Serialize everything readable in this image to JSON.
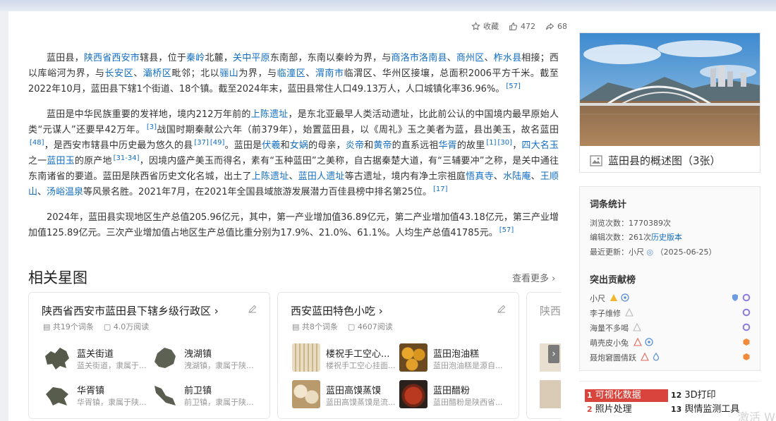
{
  "actions": {
    "favorite": "收藏",
    "likes": "472",
    "shares": "68"
  },
  "article": {
    "p1": [
      {
        "t": "蓝田县，"
      },
      {
        "t": "陕西省西安市",
        "link": true
      },
      {
        "t": "辖县，位于"
      },
      {
        "t": "秦岭",
        "link": true
      },
      {
        "t": "北麓，"
      },
      {
        "t": "关中平原",
        "link": true
      },
      {
        "t": "东南部，东南以秦岭为界，与"
      },
      {
        "t": "商洛市洛南县",
        "link": true
      },
      {
        "t": "、"
      },
      {
        "t": "商州区",
        "link": true
      },
      {
        "t": "、"
      },
      {
        "t": "柞水县",
        "link": true
      },
      {
        "t": "相接；西以库峪河为界，与"
      },
      {
        "t": "长安区",
        "link": true
      },
      {
        "t": "、"
      },
      {
        "t": "灞桥区",
        "link": true
      },
      {
        "t": "毗邻；北以"
      },
      {
        "t": "骊山",
        "link": true
      },
      {
        "t": "为界，与"
      },
      {
        "t": "临潼区",
        "link": true
      },
      {
        "t": "、"
      },
      {
        "t": "渭南市",
        "link": true
      },
      {
        "t": "临渭区、华州区接壤，总面积2006平方千米。截至2022年10月，蓝田县下辖1个街道、18个镇。截至2024年末，蓝田县常住人口49.13万人，人口城镇化率36.96%。"
      },
      {
        "t": "[57]",
        "sup": true
      }
    ],
    "p2": [
      {
        "t": "蓝田是中华民族重要的发祥地，境内212万年前的"
      },
      {
        "t": "上陈遗址",
        "link": true
      },
      {
        "t": "，是东北亚最早人类活动遗址，比此前公认的中国境内最早原始人类“元谋人”还要早42万年。"
      },
      {
        "t": "[3]",
        "sup": true
      },
      {
        "t": "战国时期秦献公六年（前379年），始置蓝田县，以《周礼》玉之美者为蓝，县出美玉，故名蓝田"
      },
      {
        "t": "[48]",
        "sup": true
      },
      {
        "t": "，是西安市辖县中历史最为悠久的县"
      },
      {
        "t": "[37]",
        "sup": true
      },
      {
        "t": "[49]",
        "sup": true
      },
      {
        "t": "。蓝田是"
      },
      {
        "t": "伏羲",
        "link": true
      },
      {
        "t": "和"
      },
      {
        "t": "女娲",
        "link": true
      },
      {
        "t": "的母亲，"
      },
      {
        "t": "炎帝",
        "link": true
      },
      {
        "t": "和"
      },
      {
        "t": "黄帝",
        "link": true
      },
      {
        "t": "的直系远祖"
      },
      {
        "t": "华胥",
        "link": true
      },
      {
        "t": "的故里"
      },
      {
        "t": "[1]",
        "sup": true
      },
      {
        "t": "[30]",
        "sup": true
      },
      {
        "t": "，"
      },
      {
        "t": "四大名玉",
        "link": true
      },
      {
        "t": "之一"
      },
      {
        "t": "蓝田玉",
        "link": true
      },
      {
        "t": "的原产地"
      },
      {
        "t": "[31-34]",
        "sup": true
      },
      {
        "t": "，因境内盛产美玉而得名，素有“玉种蓝田”之美称，自古据秦楚大道，有“三辅要冲”之称，是关中通往东南诸省的要道。蓝田是陕西省历史文化名城，出土了"
      },
      {
        "t": "上陈遗址",
        "link": true
      },
      {
        "t": "、"
      },
      {
        "t": "蓝田人遗址",
        "link": true
      },
      {
        "t": "等古遗址，境内有净土宗祖庭"
      },
      {
        "t": "悟真寺",
        "link": true
      },
      {
        "t": "、"
      },
      {
        "t": "水陆庵",
        "link": true
      },
      {
        "t": "、"
      },
      {
        "t": "王顺山",
        "link": true
      },
      {
        "t": "、"
      },
      {
        "t": "汤峪温泉",
        "link": true
      },
      {
        "t": "等风景名胜。2021年7月，在2021年全国县域旅游发展潜力百佳县榜中排名第25位。"
      },
      {
        "t": "[17]",
        "sup": true
      }
    ],
    "p3": [
      {
        "t": "2024年，蓝田县实现地区生产总值205.96亿元，其中，第一产业增加值36.89亿元，第二产业增加值43.18亿元，第三产业增加值125.89亿元。三次产业增加值占地区生产总值比重分别为17.9%、21.0%、61.1%。人均生产总值41785元。"
      },
      {
        "t": "[57]",
        "sup": true
      }
    ]
  },
  "related": {
    "title": "相关星图",
    "more": "查看更多",
    "cards": [
      {
        "title": "陕西省西安市蓝田县下辖乡级行政区",
        "count": "共19个词条",
        "reads": "4.0万阅读",
        "items": [
          {
            "name": "蓝关街道",
            "desc": "蓝关街道，隶属于..."
          },
          {
            "name": "洩湖镇",
            "desc": "洩湖镇，隶属于陕..."
          },
          {
            "name": "华胥镇",
            "desc": "华胥镇，隶属于陕..."
          },
          {
            "name": "前卫镇",
            "desc": "前卫镇，隶属于陕..."
          }
        ]
      },
      {
        "title": "西安蓝田特色小吃",
        "count": "共8个词条",
        "reads": "4607阅读",
        "items": [
          {
            "name": "楼祝手工空心...",
            "desc": "楼祝手工空心挂面..."
          },
          {
            "name": "蓝田泡油糕",
            "desc": "蓝田泡油糕是源自..."
          },
          {
            "name": "蓝田高馍蒸馍",
            "desc": "蓝田高馍蒸馍是流..."
          },
          {
            "name": "蓝田醋粉",
            "desc": "蓝田醋粉是陕西省..."
          }
        ]
      },
      {
        "title": "陕西"
      }
    ]
  },
  "album": {
    "caption": "蓝田县的概述图（3张）"
  },
  "stats": {
    "title": "词条统计",
    "views": "浏览次数：1770389次",
    "edits_prefix": "编辑次数：261次",
    "edits_link": "历史版本",
    "updated_prefix": "最近更新：",
    "updated_user": "小尺",
    "updated_date": "（2025-06-25）",
    "contrib_title": "突出贡献榜",
    "contributors": [
      "小尺",
      "李子维修",
      "海量不多喝",
      "萌壳皮小兔",
      "聂炮窘圜倩跃"
    ]
  },
  "hotlist": [
    {
      "num": "1",
      "label": "可视化数据"
    },
    {
      "num": "12",
      "label": "3D打印"
    },
    {
      "num": "2",
      "label": "照片处理"
    },
    {
      "num": "13",
      "label": "舆情监测工具"
    }
  ],
  "watermark": "激活 W",
  "colors": {
    "link": "#136ec2",
    "hot_first_bg": "#d9453c",
    "accent_orange": "#f39c12"
  }
}
